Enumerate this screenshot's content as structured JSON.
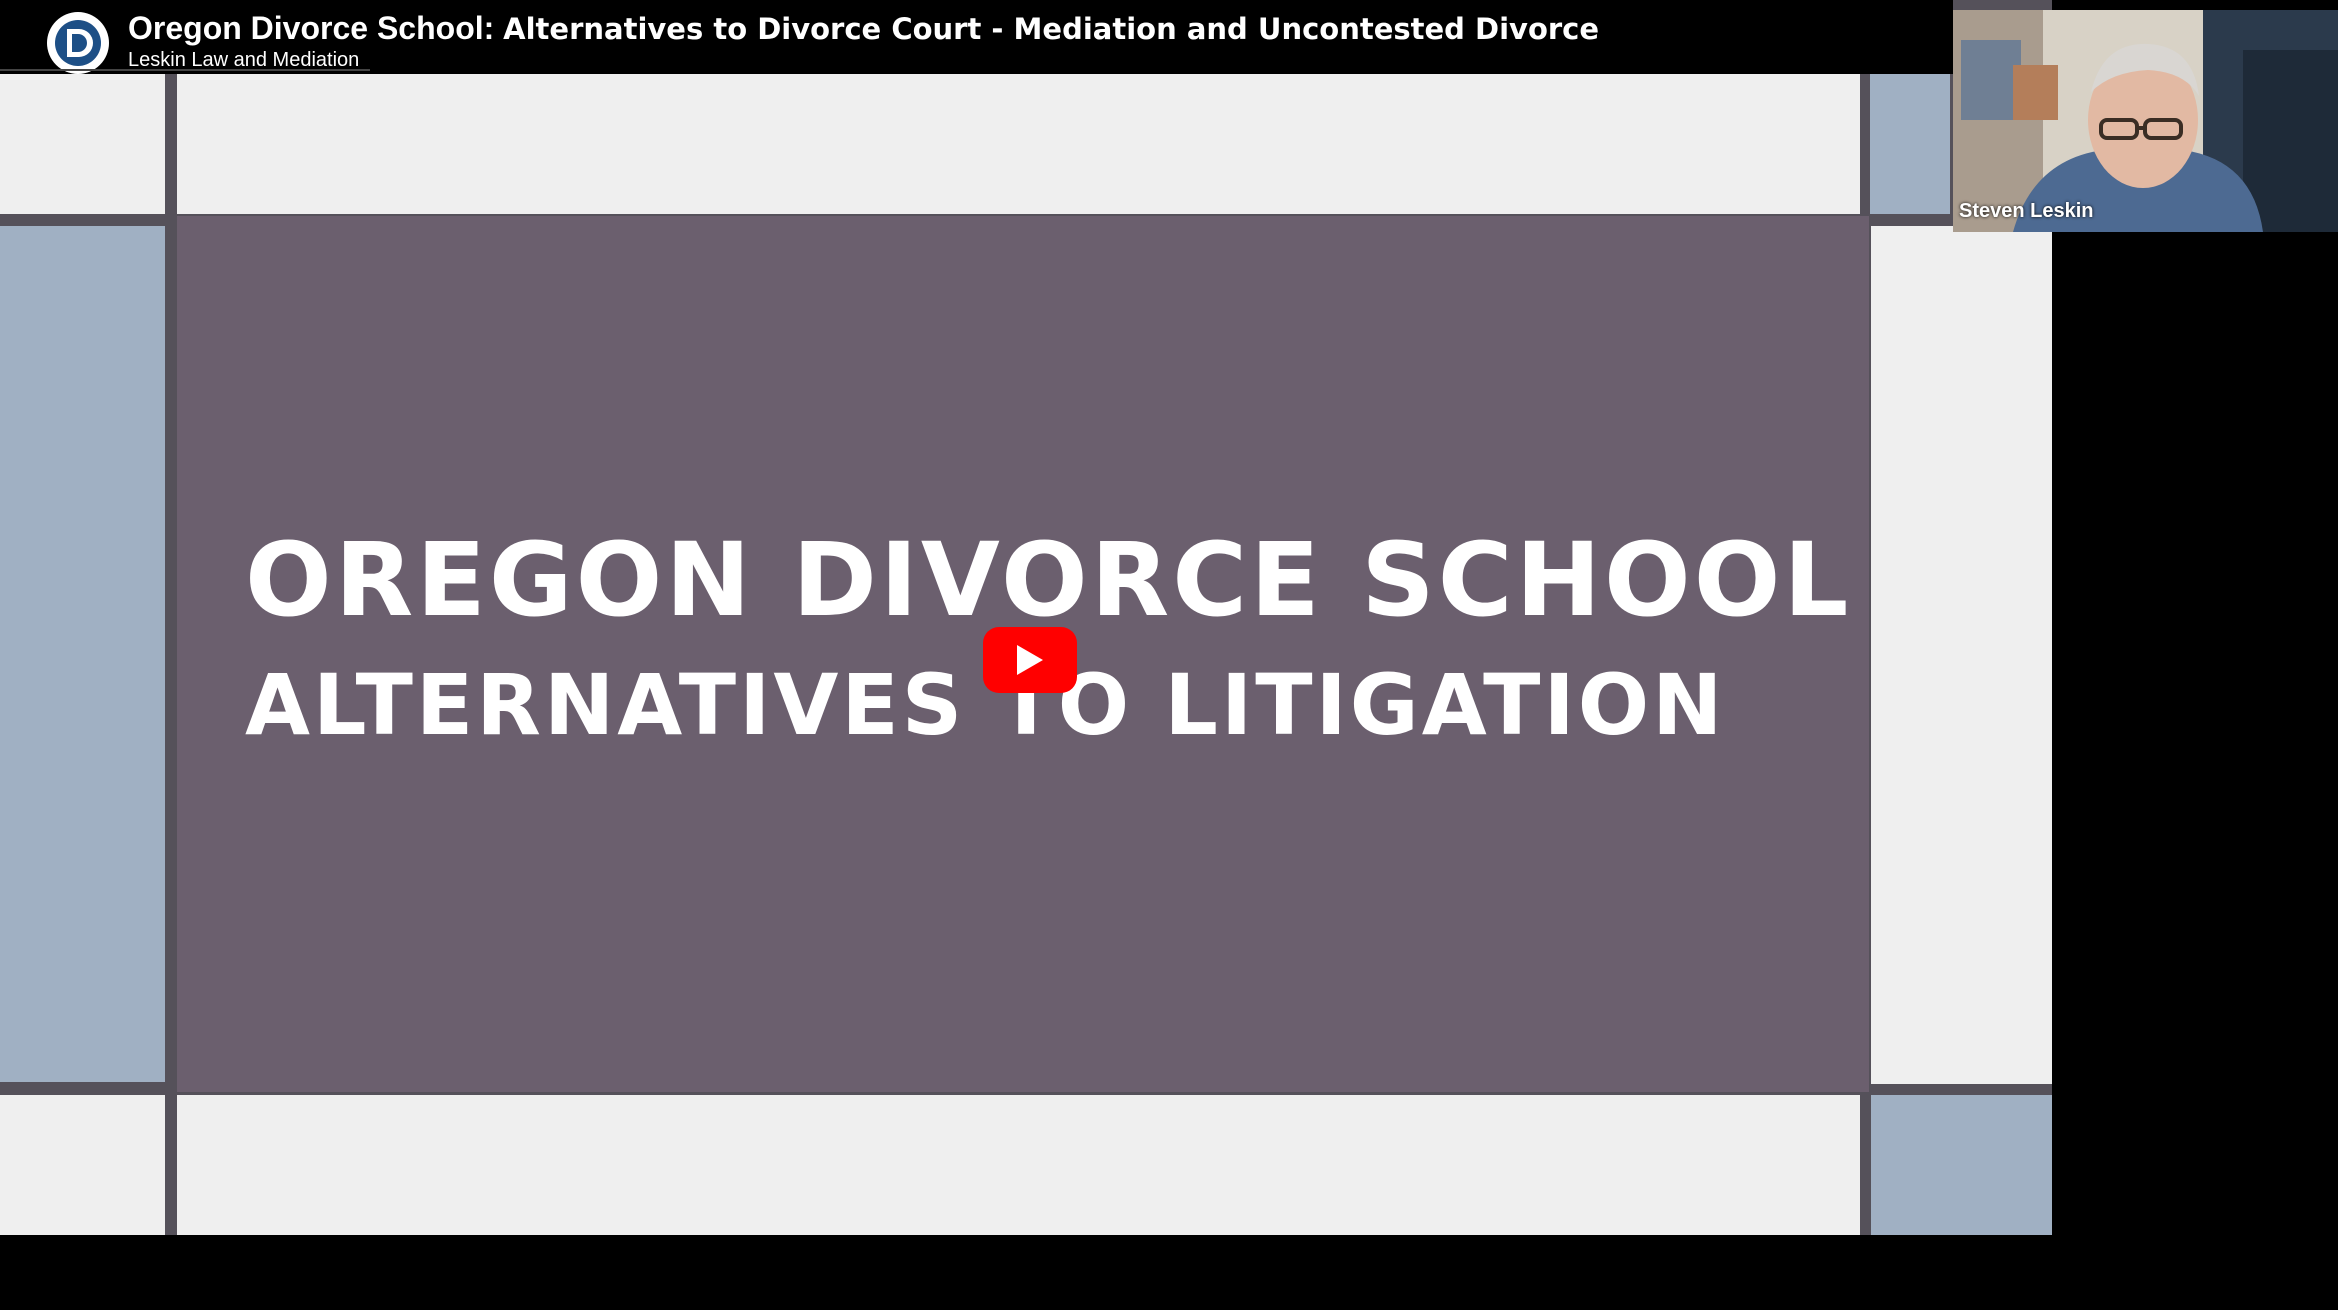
{
  "video": {
    "title_bold": "Oregon Divorce School:",
    "title_rest": "Alternatives to Divorce Court - Mediation and Uncontested Divorce",
    "channel": "Leskin Law and Mediation"
  },
  "slide": {
    "title": "OREGON DIVORCE SCHOOL",
    "subtitle": "ALTERNATIVES TO LITIGATION"
  },
  "participant": {
    "name": "Steven Leskin"
  },
  "icons": {
    "channel": "channel-logo-icon",
    "play": "play-icon"
  },
  "colors": {
    "play_button": "#ff0000",
    "slide_main": "#6b5f6e",
    "slide_accent_blue": "#a0b0c3"
  }
}
